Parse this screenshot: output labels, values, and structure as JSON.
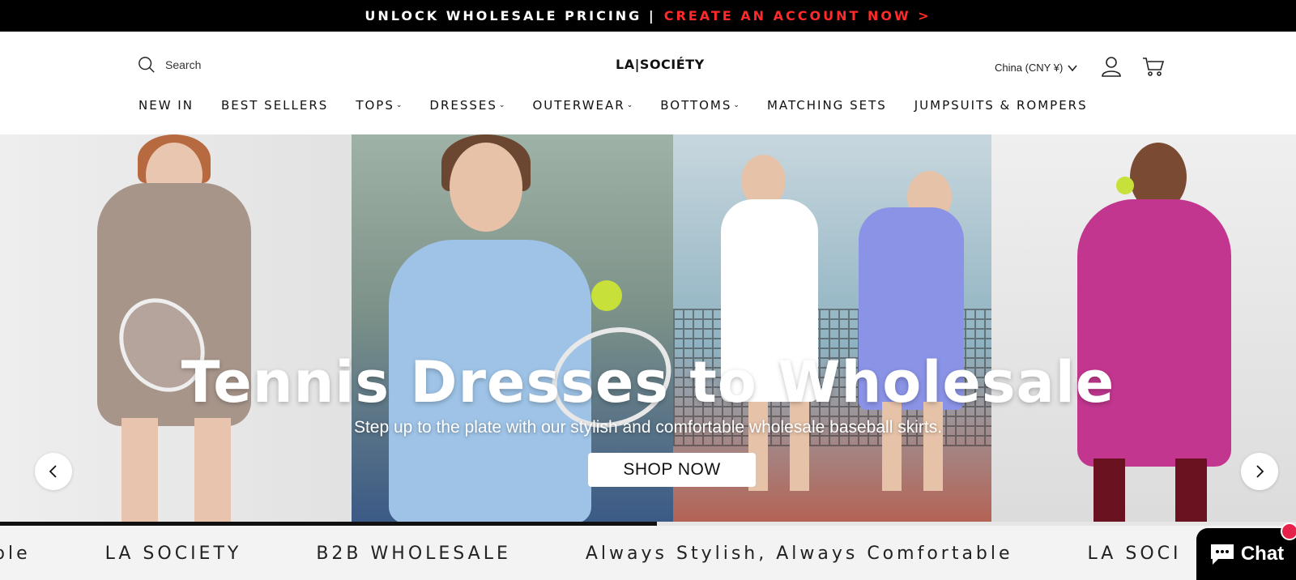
{
  "announcement": {
    "text": "UNLOCK WHOLESALE PRICING |",
    "cta": "CREATE AN ACCOUNT NOW >",
    "cta_color": "#ff2a2a"
  },
  "header": {
    "search_placeholder": "Search",
    "logo": "LA|SOCIÉTY",
    "currency": "China (CNY ¥)",
    "icons": [
      "search-icon",
      "chevron-down-icon",
      "account-icon",
      "cart-icon"
    ]
  },
  "nav": [
    {
      "label": "NEW IN",
      "dropdown": false
    },
    {
      "label": "BEST SELLERS",
      "dropdown": false
    },
    {
      "label": "TOPS",
      "dropdown": true
    },
    {
      "label": "DRESSES",
      "dropdown": true
    },
    {
      "label": "OUTERWEAR",
      "dropdown": true
    },
    {
      "label": "BOTTOMS",
      "dropdown": true
    },
    {
      "label": "MATCHING SETS",
      "dropdown": false
    },
    {
      "label": "JUMPSUITS & ROMPERS",
      "dropdown": false
    }
  ],
  "hero": {
    "title": "Tennis Dresses to Wholesale",
    "subtitle": "Step up to the plate with our stylish and comfortable wholesale baseball skirts.",
    "button": "SHOP NOW",
    "slide_progress": 0.507
  },
  "marquee": [
    "ble",
    "LA SOCIETY",
    "B2B WHOLESALE",
    "Always Stylish, Always Comfortable",
    "LA SOCI"
  ],
  "chat": {
    "label": "Chat"
  }
}
